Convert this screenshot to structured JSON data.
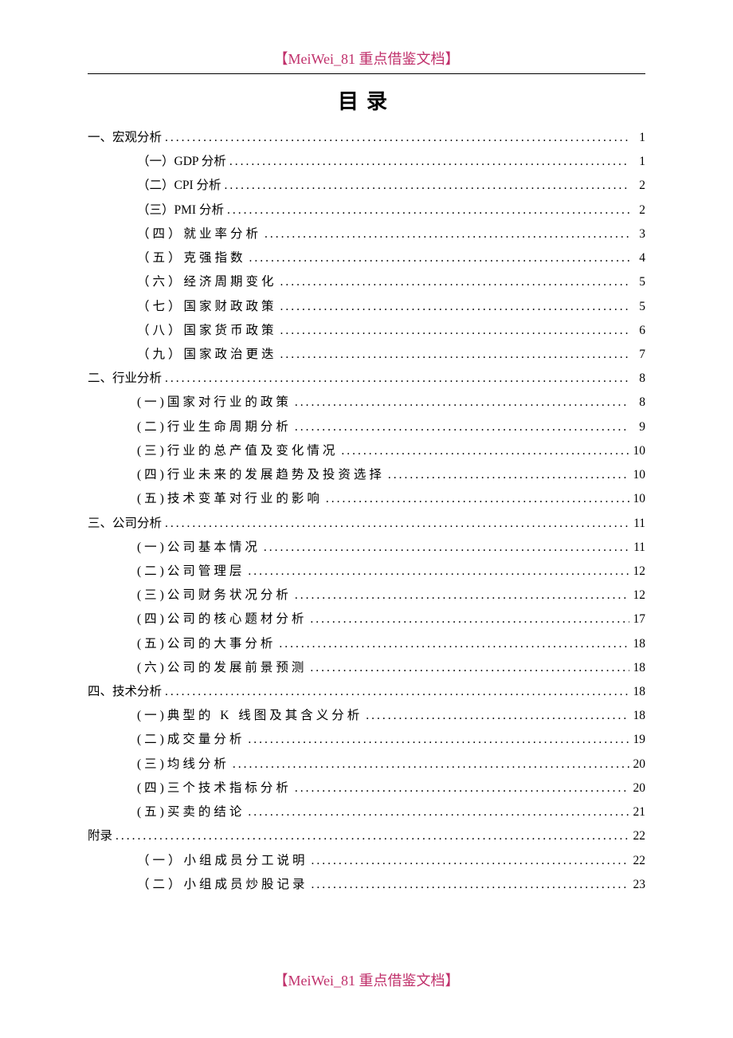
{
  "header_tag": "【MeiWei_81 重点借鉴文档】",
  "footer_tag": "【MeiWei_81 重点借鉴文档】",
  "toc_title": "目录",
  "sections": [
    {
      "label": "一、宏观分析",
      "page": "1",
      "items": [
        {
          "label": "（一）GDP 分析",
          "page": "1"
        },
        {
          "label": "（二）CPI 分析",
          "page": "2"
        },
        {
          "label": "（三）PMI 分析",
          "page": "2"
        },
        {
          "label": "（四）就业率分析",
          "page": "3",
          "letter_spaced": true
        },
        {
          "label": "（五）克强指数",
          "page": "4",
          "letter_spaced": true
        },
        {
          "label": "（六）经济周期变化",
          "page": "5",
          "letter_spaced": true
        },
        {
          "label": "（七）国家财政政策",
          "page": "5",
          "letter_spaced": true
        },
        {
          "label": "（八）国家货币政策",
          "page": "6",
          "letter_spaced": true
        },
        {
          "label": "（九）国家政治更迭",
          "page": "7",
          "letter_spaced": true
        }
      ]
    },
    {
      "label": "二、行业分析",
      "page": "8",
      "items": [
        {
          "label": "(一)国家对行业的政策",
          "page": "8",
          "letter_spaced": true
        },
        {
          "label": "(二)行业生命周期分析",
          "page": "9",
          "letter_spaced": true
        },
        {
          "label": "(三)行业的总产值及变化情况",
          "page": "10",
          "letter_spaced": true
        },
        {
          "label": "(四)行业未来的发展趋势及投资选择",
          "page": "10",
          "letter_spaced": true
        },
        {
          "label": "(五)技术变革对行业的影响",
          "page": "10",
          "letter_spaced": true
        }
      ]
    },
    {
      "label": "三、公司分析",
      "page": "11",
      "items": [
        {
          "label": "(一)公司基本情况",
          "page": "11",
          "letter_spaced": true
        },
        {
          "label": "(二)公司管理层",
          "page": "12",
          "letter_spaced": true
        },
        {
          "label": "(三)公司财务状况分析",
          "page": "12",
          "letter_spaced": true
        },
        {
          "label": "(四)公司的核心题材分析",
          "page": "17",
          "letter_spaced": true
        },
        {
          "label": "(五)公司的大事分析",
          "page": "18",
          "letter_spaced": true
        },
        {
          "label": "(六)公司的发展前景预测",
          "page": "18",
          "letter_spaced": true
        }
      ]
    },
    {
      "label": "四、技术分析",
      "page": "18",
      "items": [
        {
          "label": "(一)典型的 K 线图及其含义分析",
          "page": "18",
          "letter_spaced": true
        },
        {
          "label": "(二)成交量分析",
          "page": "19",
          "letter_spaced": true
        },
        {
          "label": "(三)均线分析",
          "page": "20",
          "letter_spaced": true
        },
        {
          "label": "(四)三个技术指标分析",
          "page": "20",
          "letter_spaced": true
        },
        {
          "label": "(五)买卖的结论",
          "page": "21",
          "letter_spaced": true
        }
      ]
    },
    {
      "label": "附录",
      "page": "22",
      "items": [
        {
          "label": "（一）小组成员分工说明",
          "page": "22",
          "letter_spaced": true
        },
        {
          "label": "（二）小组成员炒股记录",
          "page": "23",
          "letter_spaced": true
        }
      ]
    }
  ]
}
